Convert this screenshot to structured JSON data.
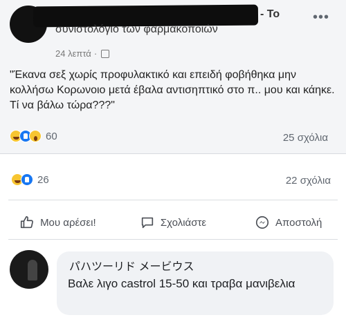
{
  "embedded_post": {
    "group_prefix": "- Το",
    "group_name": "συνιστολόγιο των φαρμακοποιών",
    "time": "24 λεπτά",
    "separator": "·",
    "more_icon": "more-dots-icon",
    "text": "\"Έκανα σεξ χωρίς προφυλακτικό και επειδή φοβήθηκα μην κολλήσω Κορωνοιο μετά έβαλα αντισηπτικό στο π.. μου και κάηκε. Τί να βάλω τώρα???\"",
    "reaction_count": "60",
    "comments": "25 σχόλια"
  },
  "post": {
    "reaction_count": "26",
    "comments": "22 σχόλια"
  },
  "actions": {
    "like": "Μου αρέσει!",
    "comment": "Σχολιάστε",
    "share": "Αποστολή"
  },
  "comment": {
    "author": "パハツーリド メービウス",
    "text": "Βαλε λιγο castrol 15-50 και τραβα μανιβελια"
  },
  "colors": {
    "accent": "#1877f2",
    "text": "#1c1e21",
    "muted": "#606770"
  }
}
